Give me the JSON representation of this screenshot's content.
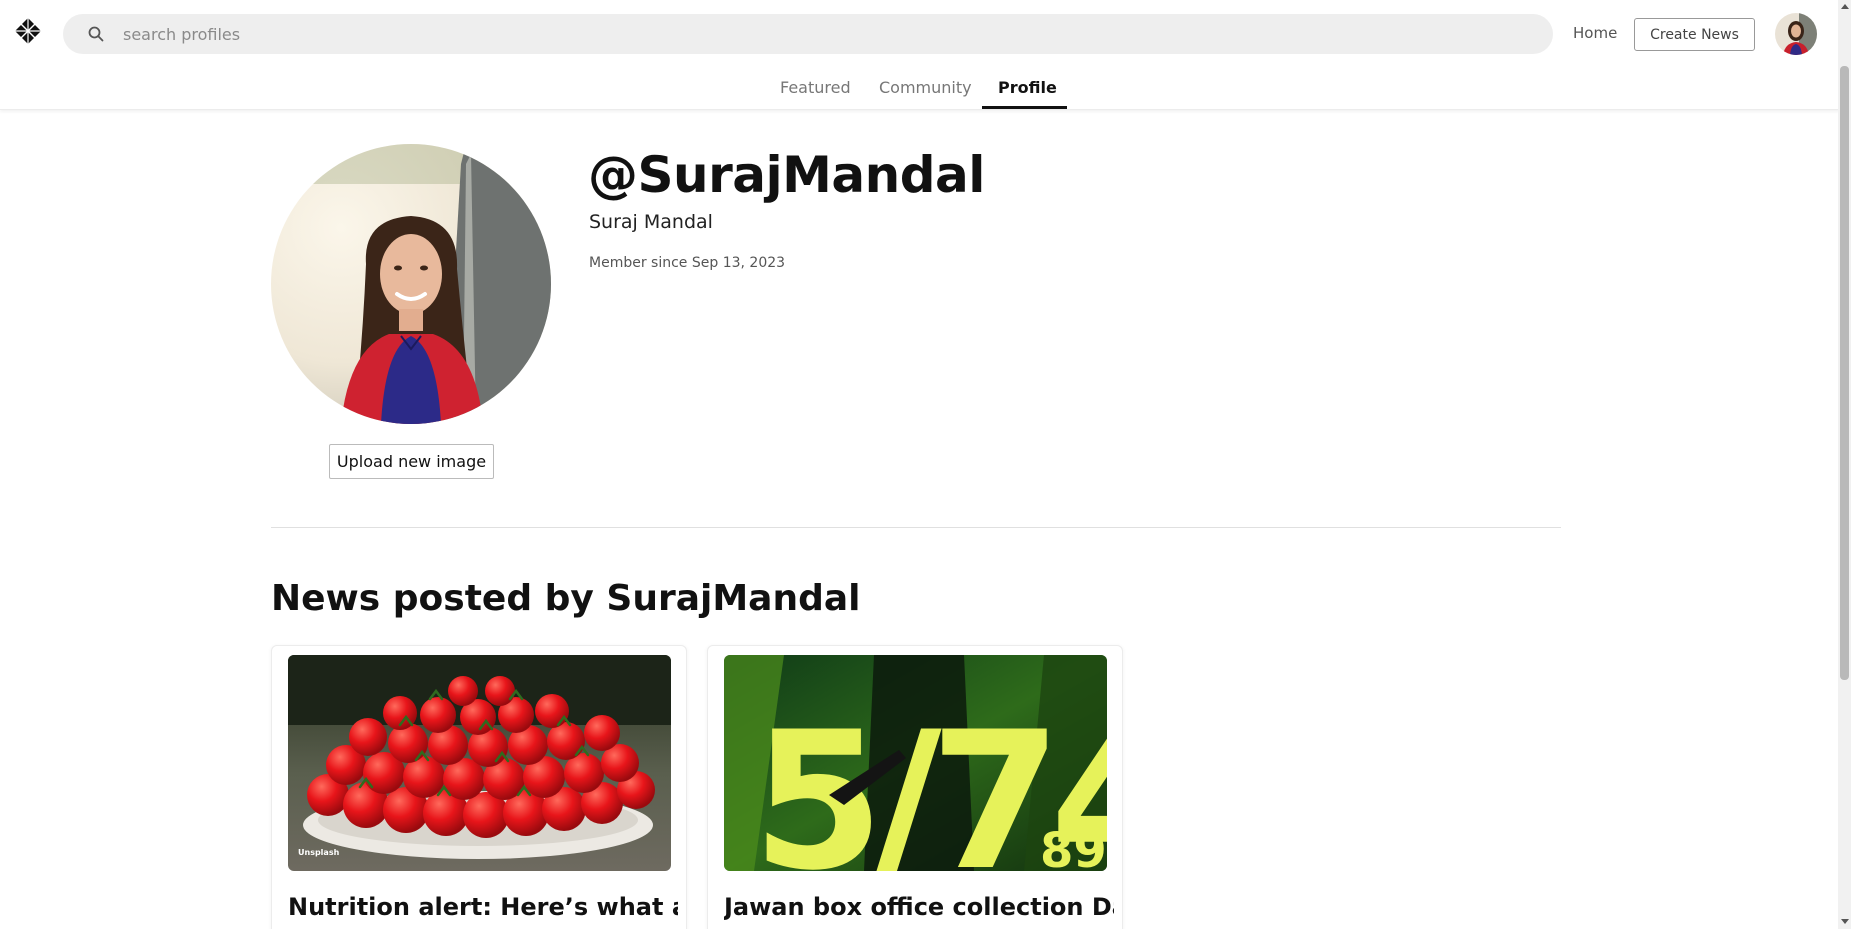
{
  "header": {
    "search_placeholder": "search profiles",
    "home_label": "Home",
    "create_label": "Create News"
  },
  "tabs": [
    {
      "label": "Featured",
      "active": false
    },
    {
      "label": "Community",
      "active": false
    },
    {
      "label": "Profile",
      "active": true
    }
  ],
  "profile": {
    "handle": "@SurajMandal",
    "full_name": "Suraj Mandal",
    "member_since": "Member since Sep 13, 2023",
    "upload_label": "Upload new image"
  },
  "news": {
    "title": "News posted by SurajMandal",
    "cards": [
      {
        "title": "Nutrition alert: Here’s what a",
        "image": "tomatoes-photo",
        "credit": "Unsplash"
      },
      {
        "title": "Jawan box office collection Day",
        "image": "jawan-poster",
        "poster_text": "5/74",
        "poster_sub": "89"
      }
    ]
  },
  "colors": {
    "search_bg": "#eeeeee",
    "accent": "#111111",
    "muted": "#777777"
  }
}
